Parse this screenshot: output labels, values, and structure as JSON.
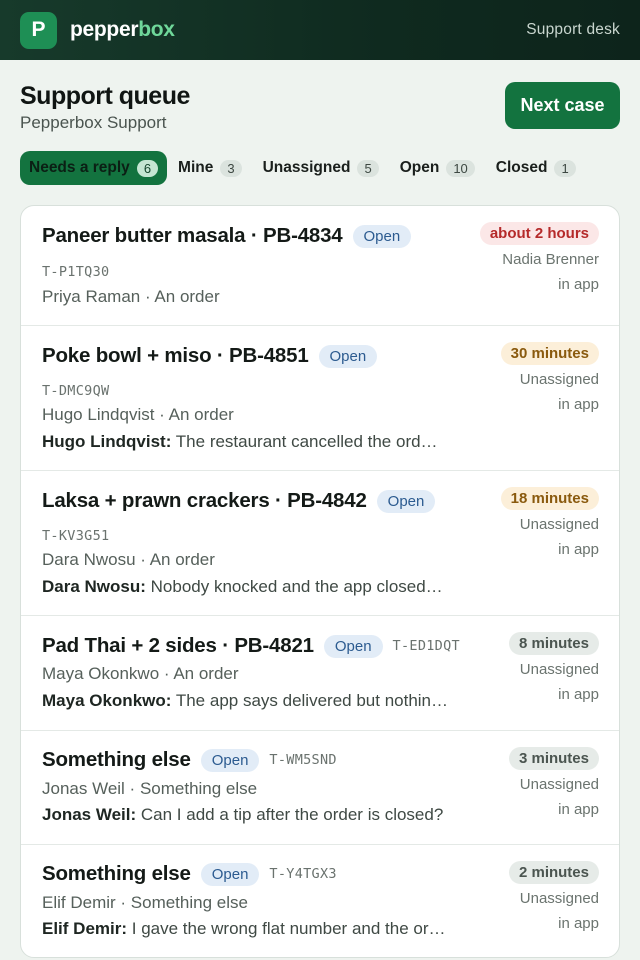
{
  "app": {
    "logo_letter": "P",
    "brand_part1": "pepper",
    "brand_part2": "box",
    "support_link": "Support desk"
  },
  "header": {
    "title": "Support queue",
    "subtitle": "Pepperbox Support",
    "next_button": "Next case"
  },
  "filters": [
    {
      "label": "Needs a reply",
      "count": "6",
      "active": true
    },
    {
      "label": "Mine",
      "count": "3",
      "active": false
    },
    {
      "label": "Unassigned",
      "count": "5",
      "active": false
    },
    {
      "label": "Open",
      "count": "10",
      "active": false
    },
    {
      "label": "Closed",
      "count": "1",
      "active": false
    }
  ],
  "cases": [
    {
      "title": "Paneer butter masala · PB-4834",
      "status": "Open",
      "ticket": "T-P1TQ30",
      "customer_line": "Priya Raman · An order",
      "message_author": "",
      "message_text": "",
      "time": "about 2 hours",
      "time_color": "red",
      "assignee": "Nadia Brenner",
      "channel": "in app"
    },
    {
      "title": "Poke bowl + miso · PB-4851",
      "status": "Open",
      "ticket": "T-DMC9QW",
      "customer_line": "Hugo Lindqvist · An order",
      "message_author": "Hugo Lindqvist:",
      "message_text": "The restaurant cancelled the ord…",
      "time": "30 minutes",
      "time_color": "amber",
      "assignee": "Unassigned",
      "channel": "in app"
    },
    {
      "title": "Laksa + prawn crackers · PB-4842",
      "status": "Open",
      "ticket": "T-KV3G51",
      "customer_line": "Dara Nwosu · An order",
      "message_author": "Dara Nwosu:",
      "message_text": "Nobody knocked and the app closed…",
      "time": "18 minutes",
      "time_color": "amber",
      "assignee": "Unassigned",
      "channel": "in app"
    },
    {
      "title": "Pad Thai + 2 sides · PB-4821",
      "status": "Open",
      "ticket": "T-ED1DQT",
      "customer_line": "Maya Okonkwo · An order",
      "message_author": "Maya Okonkwo:",
      "message_text": "The app says delivered but nothin…",
      "time": "8 minutes",
      "time_color": "gray",
      "assignee": "Unassigned",
      "channel": "in app"
    },
    {
      "title": "Something else",
      "status": "Open",
      "ticket": "T-WM5SND",
      "customer_line": "Jonas Weil · Something else",
      "message_author": "Jonas Weil:",
      "message_text": "Can I add a tip after the order is closed?",
      "time": "3 minutes",
      "time_color": "gray",
      "assignee": "Unassigned",
      "channel": "in app"
    },
    {
      "title": "Something else",
      "status": "Open",
      "ticket": "T-Y4TGX3",
      "customer_line": "Elif Demir · Something else",
      "message_author": "Elif Demir:",
      "message_text": "I gave the wrong flat number and the or…",
      "time": "2 minutes",
      "time_color": "gray",
      "assignee": "Unassigned",
      "channel": "in app"
    }
  ]
}
